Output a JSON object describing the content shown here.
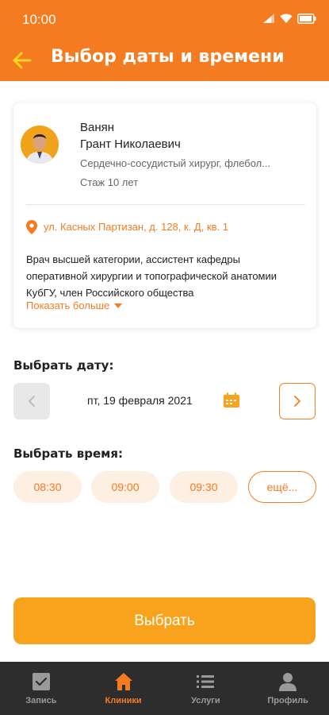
{
  "status_bar": {
    "time": "10:00"
  },
  "header": {
    "title": "Выбор даты и времени"
  },
  "doctor": {
    "last_name": "Ванян",
    "first_names": "Грант Николаевич",
    "specialty": "Сердечно-сосудистый хирург, флебол...",
    "experience": "Стаж 10 лет",
    "address": "ул. Касных Партизан, д. 128, к. Д, кв. 1",
    "description": "Врач высшей категории, ассистент кафедры оперативной хирургии и топографической анатомии КубГУ, член Российского общества",
    "show_more_label": "Показать больше"
  },
  "date_section": {
    "label": "Выбрать дату:",
    "selected_date": "пт, 19 февраля 2021"
  },
  "time_section": {
    "label": "Выбрать время:",
    "slots": [
      "08:30",
      "09:00",
      "09:30"
    ],
    "more_label": "ещё..."
  },
  "select_button": {
    "label": "Выбрать"
  },
  "tabbar": {
    "items": [
      {
        "label": "Запись",
        "icon": "checkbox-icon"
      },
      {
        "label": "Клиники",
        "icon": "home-icon"
      },
      {
        "label": "Услуги",
        "icon": "list-icon"
      },
      {
        "label": "Профиль",
        "icon": "person-icon"
      }
    ],
    "active_index": 1
  },
  "colors": {
    "accent": "#f47b20",
    "button": "#f9a21c",
    "tabbar": "#2d2d2d"
  }
}
